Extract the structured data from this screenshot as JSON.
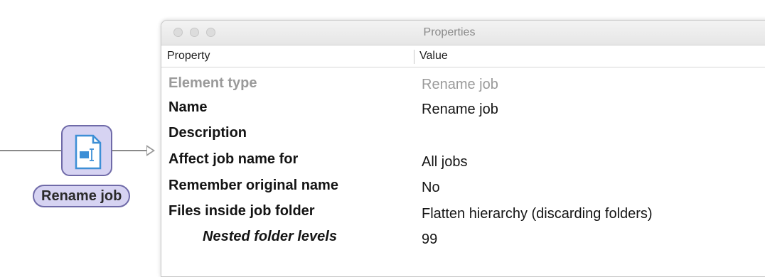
{
  "flow": {
    "element_icon": "rename-document-icon",
    "element_caption": "Rename job",
    "accent_color": "#d6d3f2",
    "border_color": "#6f6aa8"
  },
  "window": {
    "title": "Properties",
    "columns": {
      "property": "Property",
      "value": "Value"
    },
    "rows": [
      {
        "property": "Element type",
        "value": "Rename job",
        "state": "disabled"
      },
      {
        "property": "Name",
        "value": "Rename job",
        "state": "normal"
      },
      {
        "property": "Description",
        "value": "",
        "state": "normal"
      },
      {
        "property": "Affect job name for",
        "value": "All jobs",
        "state": "normal"
      },
      {
        "property": "Remember original name",
        "value": "No",
        "state": "normal"
      },
      {
        "property": "Files inside job folder",
        "value": "Flatten hierarchy (discarding folders)",
        "state": "normal"
      },
      {
        "property": "Nested folder levels",
        "value": "99",
        "state": "nested"
      }
    ]
  }
}
